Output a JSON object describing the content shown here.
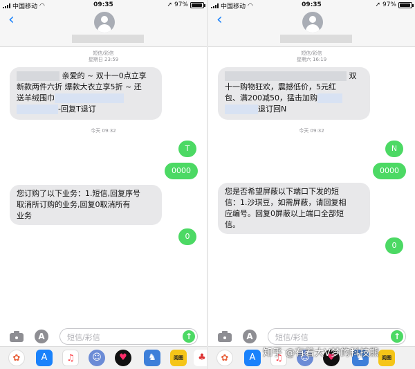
{
  "status_bar": {
    "left": {
      "carrier": "中国移动",
      "time": "09:35",
      "battery": "97%"
    },
    "right": {
      "carrier": "中国移动",
      "time": "09:35",
      "battery": "97%"
    }
  },
  "left_panel": {
    "thread_label": "短信/彩信",
    "thread_date": "星期日 23:59",
    "msg1_lines": [
      "亲爱的 ~ 双十一0点立享",
      "新款两件六折 爆款大衣立享5折 ~ 还",
      "送羊绒围巾",
      "-回复T退订"
    ],
    "divider_time": "今天 09:32",
    "reply_t": "T",
    "reply_0000": "0000",
    "msg2_lines": [
      "您订购了以下业务：1.短信,回复序号",
      "取消所订购的业务,回复0取消所有",
      "业务"
    ],
    "reply_0": "0"
  },
  "right_panel": {
    "thread_label": "短信/彩信",
    "thread_date": "星期六 16:19",
    "msg1_lines": [
      "双",
      "十一购物狂欢，震撼低价，5元红",
      "包、满200减50，猛击加购",
      "退订回N"
    ],
    "divider_time": "今天 09:32",
    "reply_n": "N",
    "reply_0000": "0000",
    "msg2_lines": [
      "您是否希望屏蔽以下端口下发的短",
      "信：1.沙琪豆，如需屏蔽，请回复相",
      "应编号。回复0屏蔽以上端口全部短",
      "信。"
    ],
    "reply_0": "0"
  },
  "composer": {
    "placeholder": "短信/彩信"
  },
  "watermark": "知乎 @有着大V梦的科技熊",
  "dock_icon_labels": {
    "tile": "阅图"
  },
  "icons": [
    "back-chevron-icon",
    "contact-avatar-icon",
    "camera-icon",
    "app-store-icon",
    "send-arrow-icon",
    "photos-icon",
    "music-icon",
    "memoji-icon",
    "heart-digital-touch-icon",
    "game-icon",
    "tile-app-icon",
    "rooster-sticker-icon"
  ],
  "colors": {
    "outgoing_bubble": "#4cd964",
    "incoming_bubble": "#e8e8ea",
    "accent_blue": "#1a82fb",
    "meta_gray": "#8e8e93"
  }
}
